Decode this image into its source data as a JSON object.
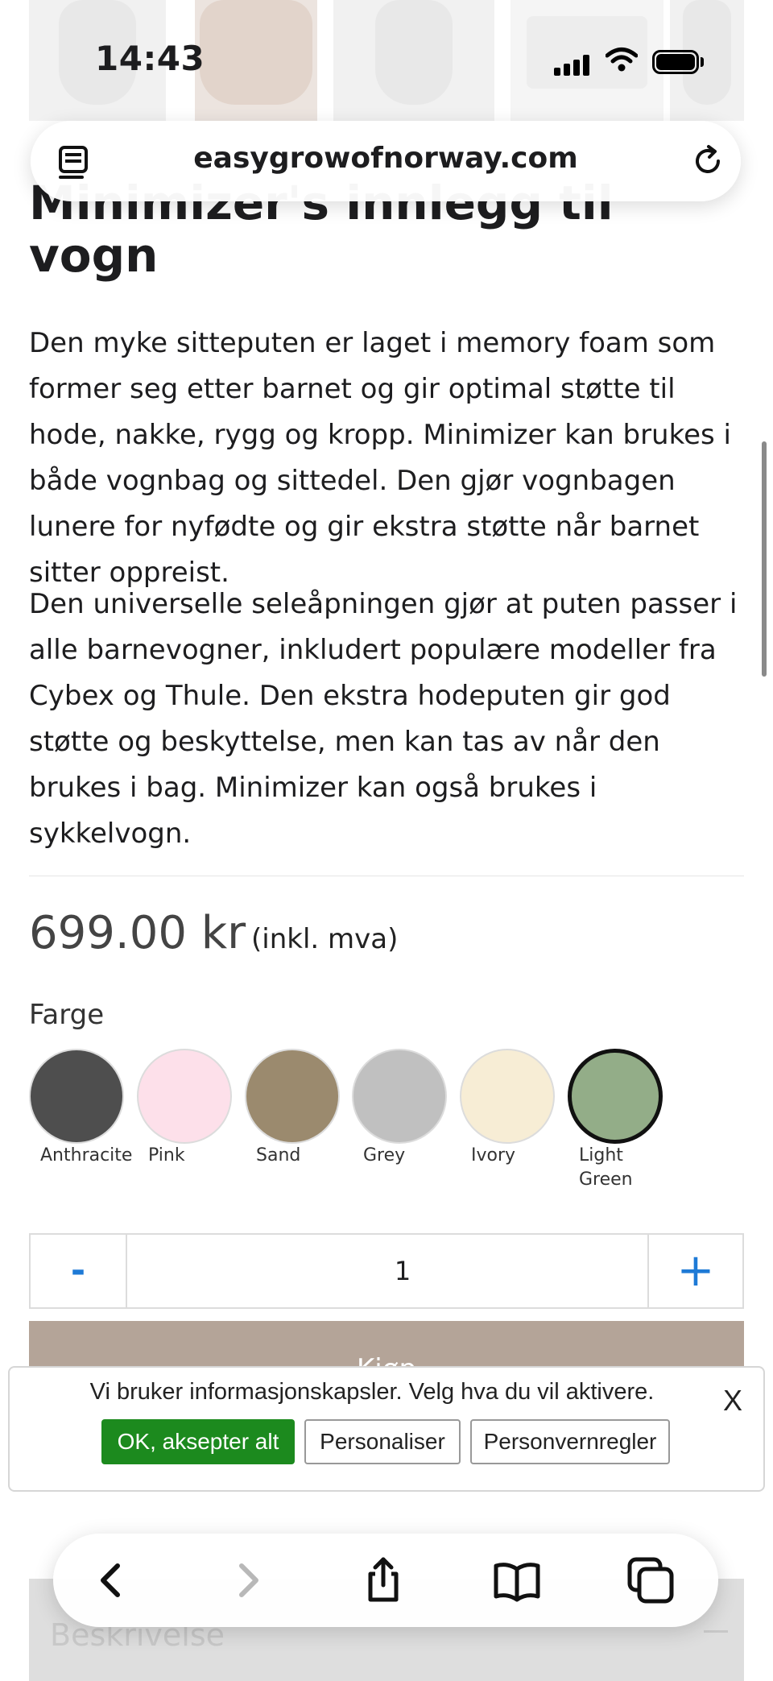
{
  "status_bar": {
    "time": "14:43"
  },
  "browser": {
    "url": "easygrowofnorway.com"
  },
  "product": {
    "title_partial": "Minimizer's innlegg til",
    "title_line2": "vogn",
    "description": [
      "Den myke sitteputen er laget i memory foam som former seg etter barnet og gir optimal støtte til hode, nakke, rygg og kropp. Minimizer kan brukes i både vognbag og sittedel. Den gjør vognbagen lunere for nyfødte og gir ekstra støtte når barnet sitter oppreist.",
      "Den universelle seleåpningen gjør at puten passer i alle barnevogner, inkludert populære modeller fra Cybex og Thule. Den ekstra hodeputen gir god støtte og beskyttelse, men kan tas av når den brukes i bag. Minimizer kan også brukes i sykkelvogn."
    ],
    "price": "699.00 kr",
    "price_note": "(inkl. mva)",
    "color_label": "Farge",
    "colors": [
      {
        "name": "Anthracite",
        "hex": "#4e4e4e"
      },
      {
        "name": "Pink",
        "hex": "#fde0ea"
      },
      {
        "name": "Sand",
        "hex": "#9b8a6e"
      },
      {
        "name": "Grey",
        "hex": "#c0c0c0"
      },
      {
        "name": "Ivory",
        "hex": "#f7edd5"
      },
      {
        "name": "Light Green",
        "hex": "#93ad88",
        "selected": true
      }
    ],
    "quantity": {
      "minus": "-",
      "value": "1",
      "plus": "+"
    },
    "cart_label": "Kjøp"
  },
  "cookie_banner": {
    "text": "Vi bruker informasjonskapsler. Velg hva du vil aktivere.",
    "close": "X",
    "accept": "OK, aksepter alt",
    "personalize": "Personaliser",
    "policy": "Personvernregler"
  },
  "section": {
    "label": "Beskrivelse"
  }
}
